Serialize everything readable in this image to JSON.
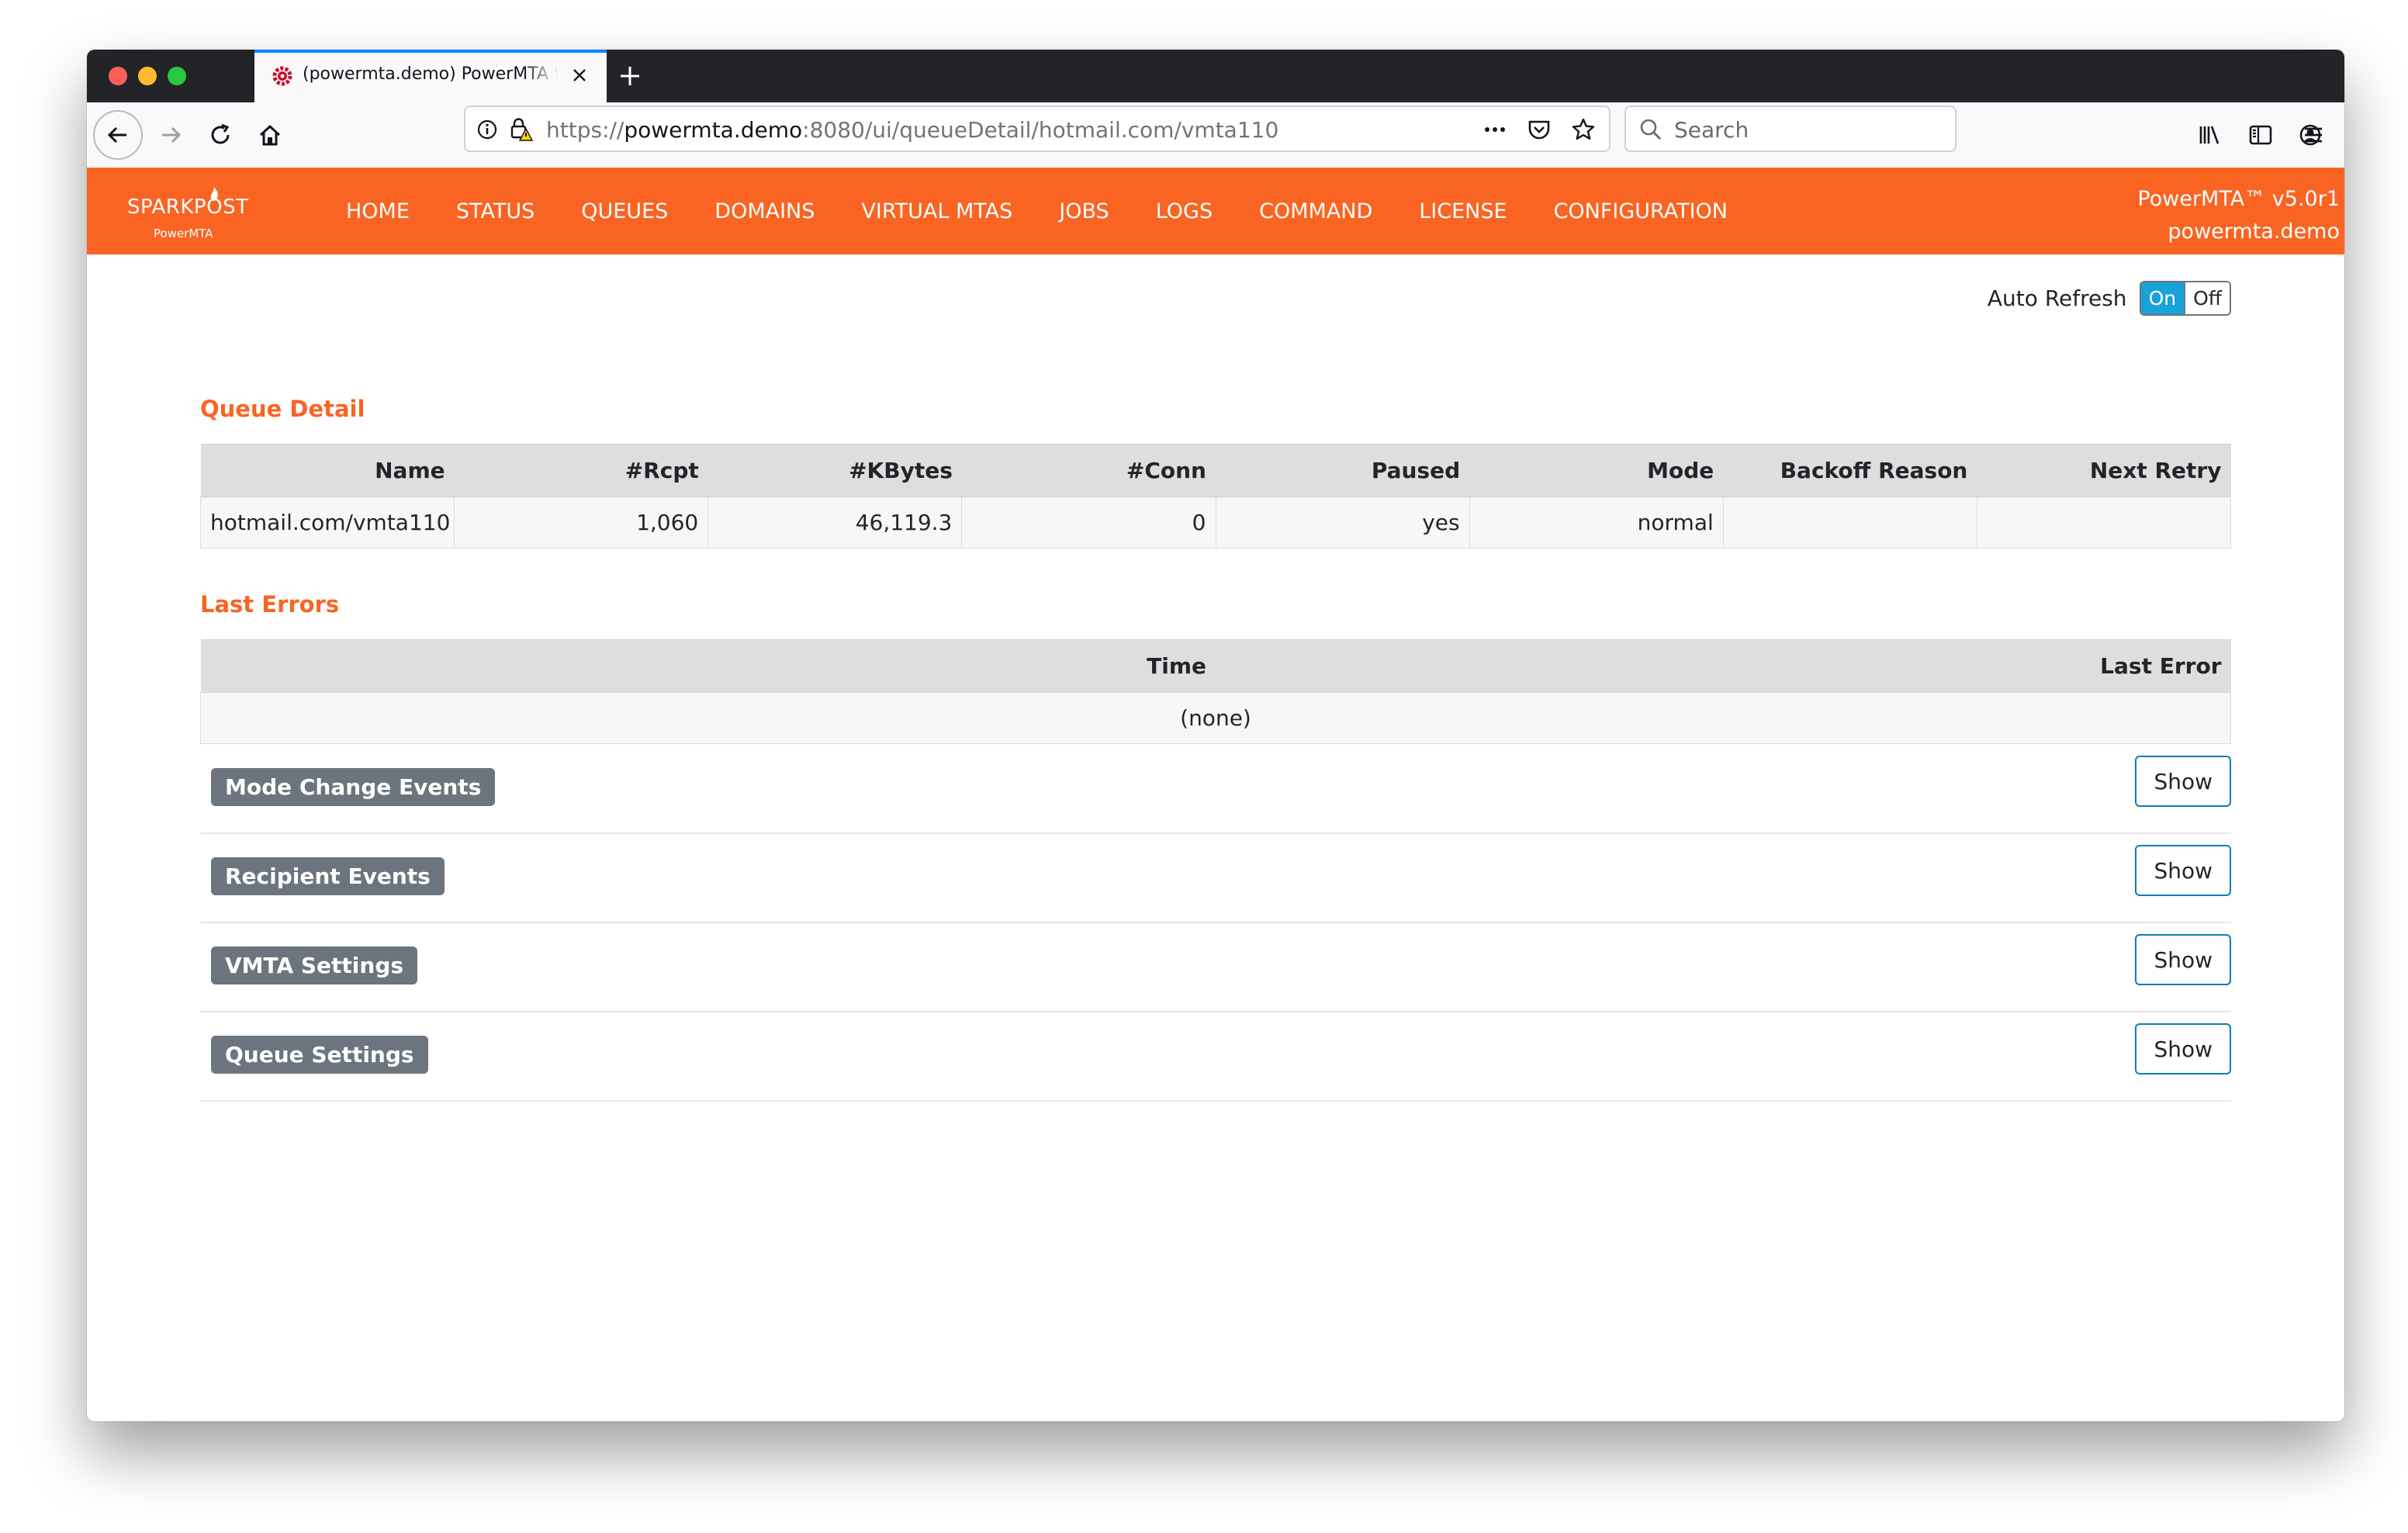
{
  "browser": {
    "tab_title": "(powermta.demo) PowerMTA Web Monitor",
    "url_prefix": "https://",
    "url_host": "powermta.demo",
    "url_path": ":8080/ui/queueDetail/hotmail.com/vmta110",
    "search_placeholder": "Search"
  },
  "nav": {
    "logo_text": "SPARKPOST",
    "logo_sub": "PowerMTA",
    "links": [
      "HOME",
      "STATUS",
      "QUEUES",
      "DOMAINS",
      "VIRTUAL MTAS",
      "JOBS",
      "LOGS",
      "COMMAND",
      "LICENSE",
      "CONFIGURATION"
    ],
    "version": "PowerMTA™ v5.0r1",
    "host": "powermta.demo"
  },
  "auto_refresh": {
    "label": "Auto Refresh",
    "on": "On",
    "off": "Off",
    "state": "On"
  },
  "queue_detail": {
    "title": "Queue Detail",
    "headers": [
      "Name",
      "#Rcpt",
      "#KBytes",
      "#Conn",
      "Paused",
      "Mode",
      "Backoff Reason",
      "Next Retry"
    ],
    "row": [
      "hotmail.com/vmta110",
      "1,060",
      "46,119.3",
      "0",
      "yes",
      "normal",
      "",
      ""
    ]
  },
  "last_errors": {
    "title": "Last Errors",
    "headers": [
      "Time",
      "Last Error"
    ],
    "empty": "(none)"
  },
  "sections": [
    {
      "label": "Mode Change Events",
      "button": "Show"
    },
    {
      "label": "Recipient Events",
      "button": "Show"
    },
    {
      "label": "VMTA Settings",
      "button": "Show"
    },
    {
      "label": "Queue Settings",
      "button": "Show"
    }
  ],
  "colors": {
    "brand": "#fa6423",
    "toggle_on": "#17a2d8",
    "badge": "#6c757d"
  }
}
